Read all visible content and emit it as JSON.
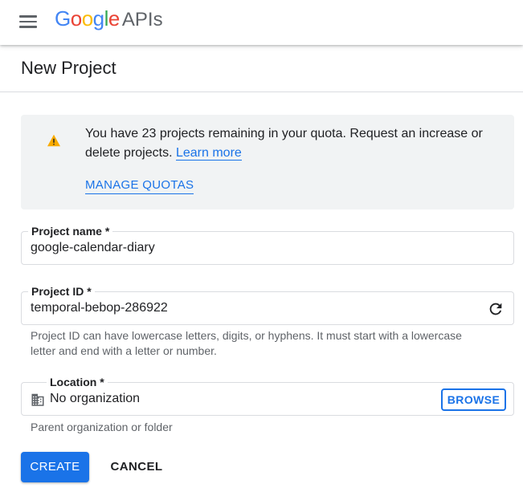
{
  "header": {
    "brand": "Google",
    "brand_letters": [
      "G",
      "o",
      "o",
      "g",
      "l",
      "e"
    ],
    "product": "APIs",
    "icons": {
      "menu": "menu-icon"
    }
  },
  "page": {
    "title": "New Project"
  },
  "quota_banner": {
    "message": "You have 23 projects remaining in your quota. Request an increase or delete projects.",
    "learn_more": "Learn more",
    "manage_quotas": "MANAGE QUOTAS",
    "icon": "warning-icon",
    "icon_color": "#f9ab00"
  },
  "form": {
    "project_name": {
      "label": "Project name *",
      "value": "google-calendar-diary"
    },
    "project_id": {
      "label": "Project ID *",
      "value": "temporal-bebop-286922",
      "helper": "Project ID can have lowercase letters, digits, or hyphens. It must start with a lowercase letter and end with a letter or number.",
      "icon": "refresh-icon"
    },
    "location": {
      "label": "Location *",
      "value": "No organization",
      "browse": "BROWSE",
      "helper": "Parent organization or folder",
      "icon": "building-icon"
    }
  },
  "actions": {
    "create": "CREATE",
    "cancel": "CANCEL"
  },
  "colors": {
    "accent": "#1a73e8",
    "banner_bg": "#f1f3f4",
    "border": "#dadce0"
  }
}
